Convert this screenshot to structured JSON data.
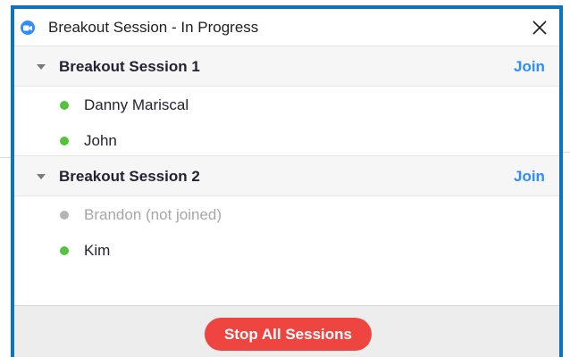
{
  "window": {
    "title": "Breakout Session - In Progress",
    "accent_color": "#0e72bd",
    "app_icon": "zoom-camera-icon",
    "close_icon": "close-icon"
  },
  "sessions": [
    {
      "name": "Breakout Session 1",
      "join_label": "Join",
      "participants": [
        {
          "name": "Danny Mariscal",
          "status": "online"
        },
        {
          "name": "John",
          "status": "online"
        }
      ]
    },
    {
      "name": "Breakout Session 2",
      "join_label": "Join",
      "participants": [
        {
          "name": "Brandon (not joined)",
          "status": "not-joined"
        },
        {
          "name": "Kim",
          "status": "online"
        }
      ]
    }
  ],
  "colors": {
    "online": "#55c13c",
    "not_joined": "#b5b5b5",
    "join_link": "#2d8cff",
    "stop_button": "#ee4540"
  },
  "footer": {
    "stop_label": "Stop All Sessions"
  }
}
